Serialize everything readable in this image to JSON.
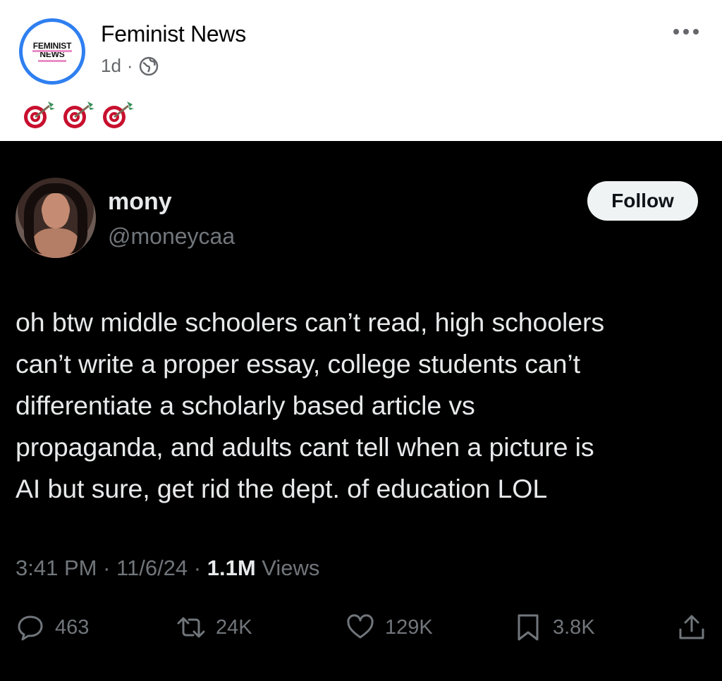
{
  "post": {
    "page_name": "Feminist News",
    "age": "1d",
    "separator": "·",
    "avatar_text_line1": "FEMINIST",
    "avatar_text_line2": "NEWS",
    "caption_icons": [
      "direct-hit-icon",
      "direct-hit-icon",
      "direct-hit-icon"
    ],
    "more_icon": "more-dots-icon",
    "privacy_icon": "globe-icon"
  },
  "tweet": {
    "display_name": "mony",
    "handle": "@moneycaa",
    "follow_label": "Follow",
    "text_lines": [
      "oh btw middle schoolers can’t read, high schoolers",
      "can’t write a proper essay, college students can’t",
      "differentiate a scholarly based article vs",
      "propaganda, and adults cant tell when a picture is",
      "AI but sure, get rid the dept. of education LOL"
    ],
    "time": "3:41 PM",
    "date": "11/6/24",
    "dot": "·",
    "views_count": "1.1M",
    "views_label": "Views",
    "replies": "463",
    "reposts": "24K",
    "likes": "129K",
    "bookmarks": "3.8K"
  },
  "colors": {
    "tweet_background": "#000000",
    "tweet_text": "#e7e9ea",
    "secondary_text": "#71767b",
    "follow_button_bg": "#eff3f4",
    "avatar_ring": "#2f7ff0",
    "target_red": "#c8102e"
  }
}
